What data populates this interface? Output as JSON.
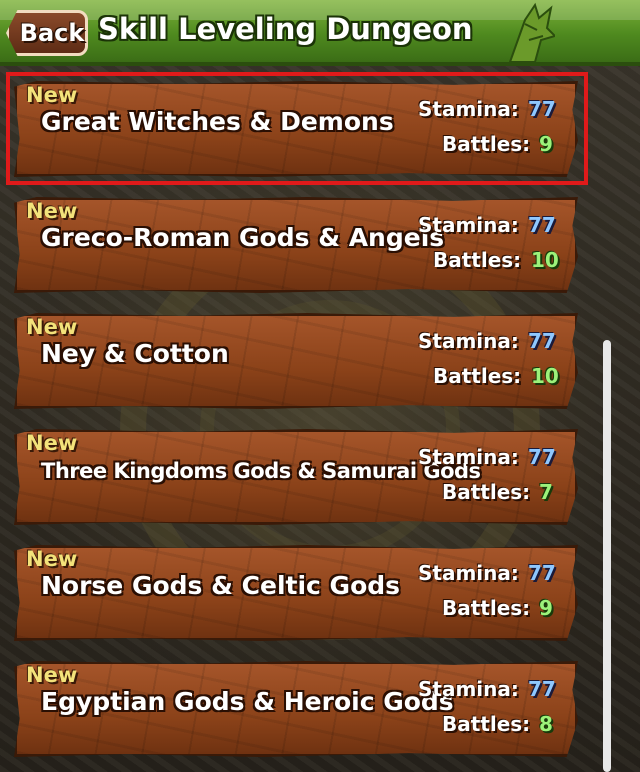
{
  "header": {
    "back_label": "Back",
    "title": "Skill Leveling Dungeon",
    "colors": {
      "header_green": "#4f8a1f",
      "highlight_red": "#e01a1a"
    }
  },
  "dungeons": [
    {
      "badge": "New",
      "name": "Great Witches & Demons",
      "stamina_label": "Stamina:",
      "stamina": "77",
      "battles_label": "Battles:",
      "battles": "9",
      "selected": true
    },
    {
      "badge": "New",
      "name": "Greco-Roman Gods & Angels",
      "stamina_label": "Stamina:",
      "stamina": "77",
      "battles_label": "Battles:",
      "battles": "10"
    },
    {
      "badge": "New",
      "name": "Ney & Cotton",
      "stamina_label": "Stamina:",
      "stamina": "77",
      "battles_label": "Battles:",
      "battles": "10"
    },
    {
      "badge": "New",
      "name": "Three Kingdoms Gods & Samurai Gods",
      "stamina_label": "Stamina:",
      "stamina": "77",
      "battles_label": "Battles:",
      "battles": "7"
    },
    {
      "badge": "New",
      "name": "Norse Gods & Celtic Gods",
      "stamina_label": "Stamina:",
      "stamina": "77",
      "battles_label": "Battles:",
      "battles": "9"
    },
    {
      "badge": "New",
      "name": "Egyptian Gods & Heroic Gods",
      "stamina_label": "Stamina:",
      "stamina": "77",
      "battles_label": "Battles:",
      "battles": "8"
    }
  ]
}
